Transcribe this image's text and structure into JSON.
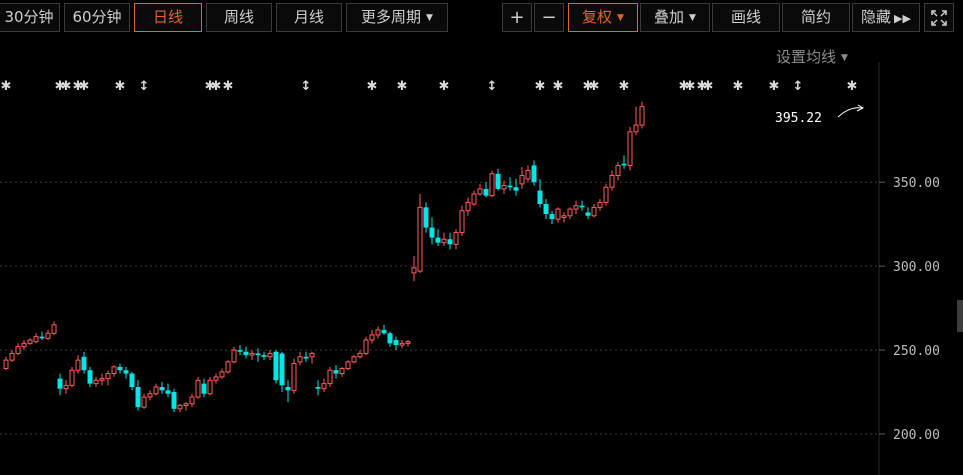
{
  "toolbar": {
    "period_buttons": [
      "30分钟",
      "60分钟",
      "日线",
      "周线",
      "月线"
    ],
    "more_periods": "更多周期",
    "plus": "+",
    "minus": "−",
    "adjust": "复权",
    "overlay": "叠加",
    "draw": "画线",
    "simple": "简约",
    "hide": "隐藏",
    "hide_icon": "double-right-arrow",
    "fullscreen_icon": "fullscreen-expand"
  },
  "ma_settings": "设置均线",
  "colors": {
    "up": "#ff5c5c",
    "down": "#00e6e6",
    "active": "#e0662a"
  },
  "chart_data": {
    "type": "candlestick",
    "y_ticks": [
      "350.00",
      "300.00",
      "250.00",
      "200.00"
    ],
    "ylim": [
      175,
      430
    ],
    "grid": "horizontal dashed",
    "last_price_label": "395.22",
    "ohlc": [
      [
        239,
        246,
        238,
        244
      ],
      [
        244,
        250,
        243,
        248
      ],
      [
        248,
        254,
        247,
        252
      ],
      [
        252,
        256,
        250,
        254
      ],
      [
        254,
        257,
        253,
        256
      ],
      [
        255,
        260,
        254,
        258
      ],
      [
        258,
        261,
        256,
        257
      ],
      [
        257,
        262,
        256,
        260
      ],
      [
        260,
        267,
        259,
        265
      ],
      [
        233,
        236,
        223,
        227
      ],
      [
        227,
        232,
        224,
        229
      ],
      [
        229,
        240,
        228,
        238
      ],
      [
        238,
        247,
        236,
        244
      ],
      [
        246,
        249,
        236,
        238
      ],
      [
        238,
        240,
        228,
        230
      ],
      [
        230,
        234,
        228,
        232
      ],
      [
        232,
        236,
        229,
        233
      ],
      [
        233,
        238,
        229,
        236
      ],
      [
        236,
        241,
        234,
        240
      ],
      [
        240,
        242,
        236,
        238
      ],
      [
        238,
        240,
        233,
        236
      ],
      [
        236,
        237,
        226,
        228
      ],
      [
        228,
        232,
        214,
        216
      ],
      [
        216,
        224,
        215,
        222
      ],
      [
        222,
        226,
        220,
        224
      ],
      [
        224,
        230,
        223,
        228
      ],
      [
        228,
        231,
        224,
        226
      ],
      [
        226,
        230,
        222,
        224
      ],
      [
        225,
        227,
        213,
        215
      ],
      [
        215,
        218,
        213,
        217
      ],
      [
        217,
        219,
        214,
        218
      ],
      [
        218,
        224,
        216,
        222
      ],
      [
        222,
        234,
        221,
        232
      ],
      [
        230,
        233,
        222,
        224
      ],
      [
        224,
        234,
        223,
        232
      ],
      [
        232,
        236,
        230,
        234
      ],
      [
        234,
        239,
        233,
        237
      ],
      [
        237,
        244,
        236,
        243
      ],
      [
        243,
        252,
        242,
        250
      ],
      [
        250,
        253,
        247,
        249
      ],
      [
        249,
        252,
        245,
        247
      ],
      [
        247,
        250,
        244,
        248
      ],
      [
        248,
        251,
        243,
        247
      ],
      [
        247,
        249,
        244,
        246
      ],
      [
        246,
        250,
        244,
        248
      ],
      [
        249,
        250,
        230,
        232
      ],
      [
        248,
        249,
        225,
        229
      ],
      [
        228,
        232,
        219,
        226
      ],
      [
        226,
        245,
        224,
        242
      ],
      [
        243,
        249,
        241,
        246
      ],
      [
        246,
        249,
        243,
        245
      ],
      [
        246,
        249,
        242,
        248
      ],
      [
        228,
        232,
        223,
        227
      ],
      [
        227,
        233,
        225,
        230
      ],
      [
        230,
        240,
        228,
        238
      ],
      [
        238,
        241,
        233,
        236
      ],
      [
        236,
        240,
        234,
        239
      ],
      [
        239,
        244,
        238,
        243
      ],
      [
        243,
        247,
        242,
        246
      ],
      [
        246,
        250,
        245,
        248
      ],
      [
        248,
        258,
        247,
        256
      ],
      [
        256,
        262,
        254,
        259
      ],
      [
        259,
        264,
        257,
        262
      ],
      [
        262,
        265,
        259,
        260
      ],
      [
        260,
        261,
        252,
        254
      ],
      [
        256,
        258,
        250,
        253
      ],
      [
        253,
        256,
        251,
        254
      ],
      [
        254,
        256,
        252,
        255
      ],
      [
        296,
        306,
        291,
        299
      ],
      [
        297,
        343,
        296,
        335
      ],
      [
        335,
        338,
        320,
        323
      ],
      [
        323,
        329,
        313,
        317
      ],
      [
        317,
        322,
        312,
        314
      ],
      [
        314,
        320,
        312,
        316
      ],
      [
        316,
        320,
        310,
        313
      ],
      [
        313,
        322,
        310,
        320
      ],
      [
        320,
        336,
        318,
        333
      ],
      [
        333,
        341,
        330,
        338
      ],
      [
        337,
        345,
        336,
        343
      ],
      [
        343,
        349,
        342,
        346
      ],
      [
        346,
        350,
        341,
        342
      ],
      [
        342,
        357,
        341,
        355
      ],
      [
        355,
        358,
        345,
        346
      ],
      [
        346,
        351,
        343,
        348
      ],
      [
        348,
        353,
        345,
        347
      ],
      [
        347,
        352,
        342,
        345
      ],
      [
        349,
        359,
        346,
        354
      ],
      [
        352,
        360,
        350,
        357
      ],
      [
        360,
        363,
        348,
        350
      ],
      [
        345,
        352,
        335,
        337
      ],
      [
        337,
        340,
        328,
        331
      ],
      [
        331,
        333,
        325,
        328
      ],
      [
        328,
        335,
        326,
        334
      ],
      [
        329,
        332,
        326,
        330
      ],
      [
        330,
        335,
        328,
        334
      ],
      [
        334,
        339,
        331,
        336
      ],
      [
        336,
        339,
        333,
        335
      ],
      [
        332,
        335,
        328,
        330
      ],
      [
        330,
        337,
        329,
        335
      ],
      [
        335,
        340,
        333,
        338
      ],
      [
        338,
        349,
        336,
        347
      ],
      [
        347,
        357,
        345,
        354
      ],
      [
        354,
        362,
        351,
        360
      ],
      [
        361,
        366,
        358,
        360
      ],
      [
        360,
        383,
        357,
        380
      ],
      [
        380,
        395,
        378,
        384
      ],
      [
        384,
        398,
        382,
        395
      ]
    ],
    "event_markers": [
      [
        0,
        "asterisk"
      ],
      [
        9,
        "asterisk"
      ],
      [
        10,
        "asterisk"
      ],
      [
        12,
        "asterisk"
      ],
      [
        13,
        "asterisk"
      ],
      [
        19,
        "asterisk"
      ],
      [
        23,
        "updown"
      ],
      [
        34,
        "asterisk"
      ],
      [
        35,
        "asterisk"
      ],
      [
        37,
        "asterisk"
      ],
      [
        50,
        "updown"
      ],
      [
        61,
        "asterisk"
      ],
      [
        66,
        "asterisk"
      ],
      [
        73,
        "asterisk"
      ],
      [
        81,
        "updown"
      ],
      [
        89,
        "asterisk"
      ],
      [
        92,
        "asterisk"
      ],
      [
        97,
        "asterisk"
      ],
      [
        98,
        "asterisk"
      ],
      [
        103,
        "asterisk"
      ],
      [
        113,
        "asterisk"
      ],
      [
        114,
        "asterisk"
      ],
      [
        116,
        "asterisk"
      ],
      [
        117,
        "asterisk"
      ],
      [
        122,
        "asterisk"
      ],
      [
        128,
        "asterisk"
      ],
      [
        132,
        "updown"
      ],
      [
        141,
        "asterisk"
      ]
    ]
  }
}
